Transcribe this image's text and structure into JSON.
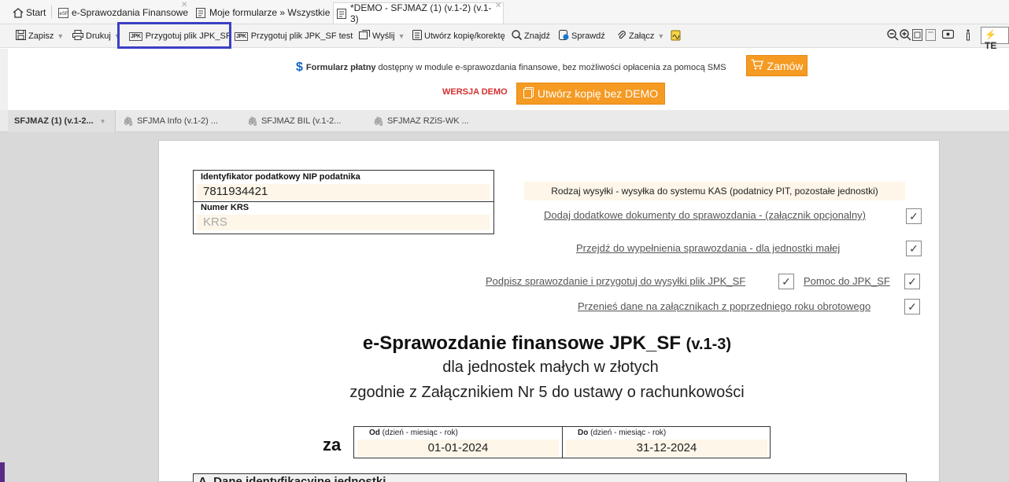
{
  "tabs": [
    {
      "label": "Start",
      "icon": "home-icon"
    },
    {
      "label": "e-Sprawozdania Finansowe",
      "icon": "esf-icon"
    },
    {
      "label": "Moje formularze » Wszystkie",
      "icon": "form-icon"
    },
    {
      "label": "*DEMO - SFJMAZ (1) (v.1-2) (v.1-3)",
      "icon": "form-icon"
    }
  ],
  "toolbar": {
    "save": "Zapisz",
    "print": "Drukuj",
    "prepare_jpk": "Przygotuj plik JPK_SF",
    "prepare_jpk_test": "Przygotuj plik JPK_SF test",
    "send": "Wyślij",
    "copy": "Utwórz kopię/korektę",
    "find": "Znajdź",
    "check": "Sprawdź",
    "attach": "Załącz",
    "jpk_badge": "JPK",
    "right_partial": "TE"
  },
  "notice": {
    "paid_bold": "Formularz płatny",
    "paid_text": "dostępny w module e-sprawozdania finansowe, bez możliwości opłacenia za pomocą SMS",
    "order_button": "Zamów",
    "demo_label": "WERSJA DEMO",
    "copy_no_demo_button": "Utwórz kopię bez DEMO"
  },
  "doc_tabs": [
    {
      "label": "SFJMAZ (1) (v.1-2...",
      "active": true
    },
    {
      "label": "SFJMA Info (v.1-2) ...",
      "active": false
    },
    {
      "label": "SFJMAZ BIL (v.1-2...",
      "active": false
    },
    {
      "label": "SFJMAZ RZiS-WK ...",
      "active": false
    }
  ],
  "form": {
    "nip_label": "Identyfikator podatkowy NIP podatnika",
    "nip_value": "7811934421",
    "krs_label": "Numer KRS",
    "krs_placeholder": "KRS",
    "send_type": "Rodzaj wysyłki - wysyłka do systemu KAS (podatnicy PIT, pozostałe jednostki)",
    "link_add_docs": "Dodaj dodatkowe dokumenty do sprawozdania - (załącznik opcjonalny)",
    "link_fill": "Przejdź do wypełnienia sprawozdania - dla jednostki małej",
    "link_sign": "Podpisz sprawozdanie i przygotuj do wysyłki plik JPK_SF",
    "link_help": "Pomoc do JPK_SF",
    "link_transfer": "Przenieś dane na załącznikach z poprzedniego roku obrotowego",
    "checkmark": "✓",
    "title_main": "e-Sprawozdanie finansowe JPK_SF",
    "title_version": "(v.1-3)",
    "subtitle1": "dla jednostek małych w złotych",
    "subtitle2": "zgodnie z Załącznikiem Nr 5 do ustawy o rachunkowości",
    "za": "za",
    "from_label_bold": "Od",
    "from_label_rest": "(dzień - miesiąc - rok)",
    "from_value": "01-01-2024",
    "to_label_bold": "Do",
    "to_label_rest": "(dzień - miesiąc - rok)",
    "to_value": "31-12-2024",
    "section_a": "A. Dane identyfikacyjne jednostki"
  }
}
